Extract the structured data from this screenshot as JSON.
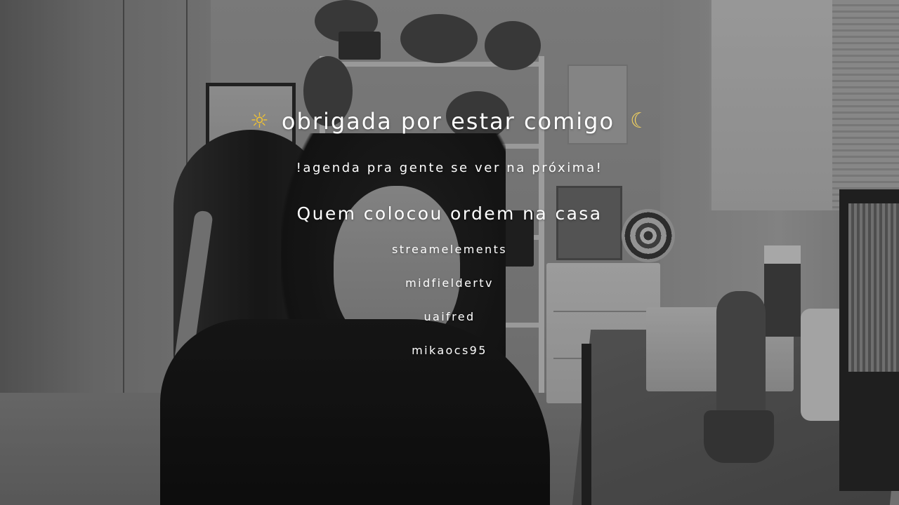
{
  "overlay": {
    "title": {
      "icon_left": "sun-with-face-icon",
      "text": "obrigada por estar comigo",
      "icon_right": "crescent-moon-icon"
    },
    "subtitle": "!agenda pra gente se ver na próxima!",
    "credits_heading": "Quem colocou ordem na casa",
    "credits": [
      "streamelements",
      "midfieldertv",
      "uaifred",
      "mikaocs95"
    ]
  }
}
